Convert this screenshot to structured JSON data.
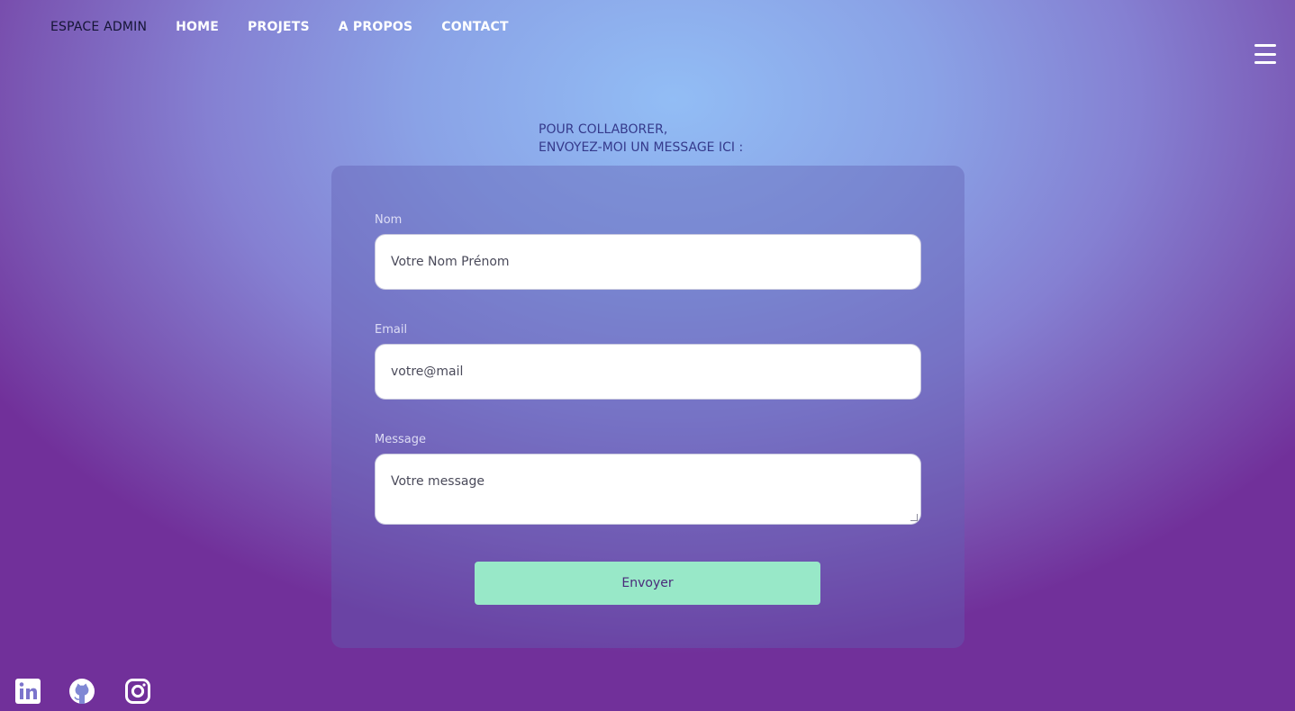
{
  "nav": {
    "admin": "ESPACE ADMIN",
    "home": "HOME",
    "projects": "PROJETS",
    "about": "A PROPOS",
    "contact": "CONTACT"
  },
  "menu_icon": "hamburger-menu-icon",
  "intro": {
    "line1": "POUR COLLABORER,",
    "line2": "ENVOYEZ-MOI UN MESSAGE ICI :"
  },
  "form": {
    "name_label": "Nom",
    "name_placeholder": "Votre Nom Prénom",
    "email_label": "Email",
    "email_placeholder": "votre@mail",
    "message_label": "Message",
    "message_placeholder": "Votre message",
    "submit_label": "Envoyer"
  },
  "social": [
    "linkedin-icon",
    "github-icon",
    "instagram-icon"
  ],
  "colors": {
    "submit_bg": "#98e8c8",
    "submit_text": "#4a2a7a",
    "intro_text": "#353a8c"
  }
}
